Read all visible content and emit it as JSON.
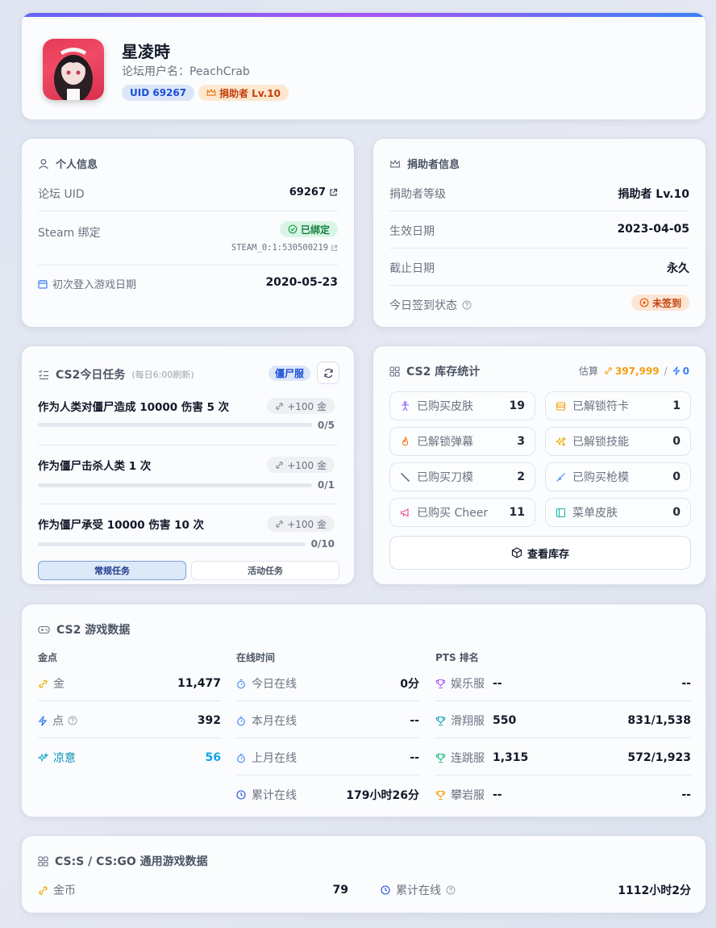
{
  "profile": {
    "name": "星凌時",
    "forum_username": "论坛用户名：PeachCrab",
    "uid_badge": "UID 69267",
    "donor_badge": "捐助者 Lv.10"
  },
  "personal": {
    "title": "个人信息",
    "uid_label": "论坛 UID",
    "uid_value": "69267",
    "steam_label": "Steam 绑定",
    "steam_status": "已绑定",
    "steam_id": "STEAM_0:1:530500219",
    "first_login_label": "初次登入游戏日期",
    "first_login_value": "2020-05-23"
  },
  "donor": {
    "title": "捐助者信息",
    "level_label": "捐助者等级",
    "level_value": "捐助者 Lv.10",
    "start_label": "生效日期",
    "start_value": "2023-04-05",
    "end_label": "截止日期",
    "end_value": "永久",
    "checkin_label": "今日签到状态",
    "checkin_status": "未签到"
  },
  "tasks": {
    "title": "CS2今日任务",
    "subtitle": "(每日6:00刷新)",
    "server_badge": "僵尸服",
    "items": [
      {
        "name": "作为人类对僵尸造成 10000 伤害 5 次",
        "reward": "+100 金",
        "progress": "0/5",
        "fraction": 0
      },
      {
        "name": "作为僵尸击杀人类 1 次",
        "reward": "+100 金",
        "progress": "0/1",
        "fraction": 0
      },
      {
        "name": "作为僵尸承受 10000 伤害 10 次",
        "reward": "+100 金",
        "progress": "0/10",
        "fraction": 0
      }
    ],
    "tab_regular": "常规任务",
    "tab_event": "活动任务"
  },
  "inventory": {
    "title": "CS2 库存统计",
    "estimate_label": "估算",
    "estimate_gold": "397,999",
    "separator": "/",
    "estimate_points": "0",
    "items": [
      {
        "label": "已购买皮肤",
        "value": "19",
        "icon": "person-icon",
        "color": "#8b5cf6"
      },
      {
        "label": "已解锁符卡",
        "value": "1",
        "icon": "card-icon",
        "color": "#f59e0b"
      },
      {
        "label": "已解锁弹幕",
        "value": "3",
        "icon": "flame-icon",
        "color": "#f97316"
      },
      {
        "label": "已解锁技能",
        "value": "0",
        "icon": "sparkle-icon",
        "color": "#eab308"
      },
      {
        "label": "已购买刀模",
        "value": "2",
        "icon": "knife-icon",
        "color": "#6b7280"
      },
      {
        "label": "已购买枪模",
        "value": "0",
        "icon": "gun-icon",
        "color": "#3b82f6"
      },
      {
        "label": "已购买 Cheer",
        "value": "11",
        "icon": "megaphone-icon",
        "color": "#ec4899"
      },
      {
        "label": "菜单皮肤",
        "value": "0",
        "icon": "panel-icon",
        "color": "#14b8a6"
      }
    ],
    "view_button": "查看库存"
  },
  "gamedata": {
    "title": "CS2 游戏数据",
    "col_points": "金点",
    "col_online": "在线时间",
    "col_pts": "PTS 排名",
    "points": [
      {
        "label": "金",
        "value": "11,477"
      },
      {
        "label": "点",
        "value": "392"
      },
      {
        "label": "凉意",
        "value": "56"
      }
    ],
    "online": [
      {
        "label": "今日在线",
        "value": "0分"
      },
      {
        "label": "本月在线",
        "value": "--"
      },
      {
        "label": "上月在线",
        "value": "--"
      },
      {
        "label": "累计在线",
        "value": "179小时26分"
      }
    ],
    "pts": [
      {
        "label": "娱乐服",
        "score": "--",
        "rank": "--",
        "color": "#a855f7"
      },
      {
        "label": "滑翔服",
        "score": "550",
        "rank": "831/1,538",
        "color": "#0ea5b7"
      },
      {
        "label": "连跳服",
        "score": "1,315",
        "rank": "572/1,923",
        "color": "#10b981"
      },
      {
        "label": "攀岩服",
        "score": "--",
        "rank": "--",
        "color": "#f59e0b"
      }
    ]
  },
  "legacy": {
    "title": "CS:S / CS:GO 通用游戏数据",
    "coin_label": "金币",
    "coin_value": "79",
    "total_label": "累计在线",
    "total_value": "1112小时2分"
  }
}
